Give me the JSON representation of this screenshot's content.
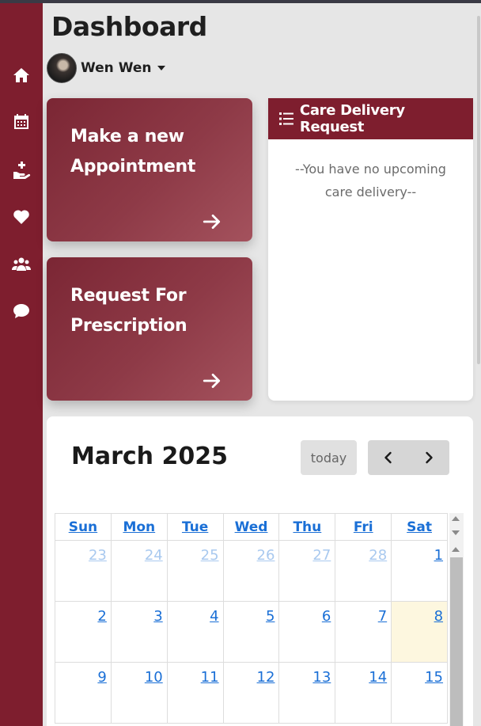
{
  "page": {
    "title": "Dashboard"
  },
  "user": {
    "name": "Wen Wen"
  },
  "sidebar": {
    "items": [
      {
        "icon": "home-icon",
        "name": "home"
      },
      {
        "icon": "calendar-icon",
        "name": "appointments"
      },
      {
        "icon": "hand-holding-medical-icon",
        "name": "prescription"
      },
      {
        "icon": "heart-icon",
        "name": "health"
      },
      {
        "icon": "users-icon",
        "name": "family"
      },
      {
        "icon": "comment-icon",
        "name": "messages"
      }
    ]
  },
  "actions": {
    "appointment_label": "Make a new Appointment",
    "prescription_label": "Request For Prescription"
  },
  "care_delivery": {
    "title": "Care Delivery Request",
    "empty_message": "--You have no upcoming care delivery--"
  },
  "calendar": {
    "title": "March 2025",
    "today_label": "today",
    "weekdays": [
      "Sun",
      "Mon",
      "Tue",
      "Wed",
      "Thu",
      "Fri",
      "Sat"
    ],
    "weeks": [
      [
        "23",
        "24",
        "25",
        "26",
        "27",
        "28",
        "1"
      ],
      [
        "2",
        "3",
        "4",
        "5",
        "6",
        "7",
        "8"
      ],
      [
        "9",
        "10",
        "11",
        "12",
        "13",
        "14",
        "15"
      ]
    ],
    "highlighted_day": "8"
  },
  "colors": {
    "brand": "#7e1e2e",
    "link": "#1a6fd6",
    "today_bg": "#fdf7df"
  }
}
